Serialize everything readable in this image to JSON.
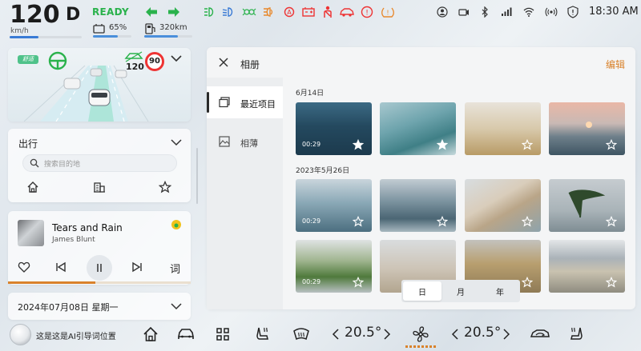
{
  "status": {
    "speed": "120",
    "speed_unit": "km/h",
    "gear": "D",
    "ready": "READY",
    "battery": "65%",
    "battery_level": 0.65,
    "range": "320km",
    "time": "18:30 AM"
  },
  "adas": {
    "mode_badge": "舒适",
    "set_speed": "120",
    "speed_limit": "90"
  },
  "nav": {
    "title": "出行",
    "search_placeholder": "搜索目的地"
  },
  "music": {
    "title": "Tears and Rain",
    "artist": "James Blunt",
    "lyrics_label": "词",
    "progress": 0.48
  },
  "date": "2024年07月08日  星期一",
  "gallery": {
    "title": "相册",
    "edit": "编辑",
    "sidebar": [
      "最近项目",
      "相薄"
    ],
    "sections": [
      {
        "label": "6月14日",
        "items": [
          {
            "duration": "00:29",
            "favorite": true
          },
          {
            "duration": "",
            "favorite": true
          },
          {
            "duration": "",
            "favorite": false
          },
          {
            "duration": "",
            "favorite": false
          }
        ]
      },
      {
        "label": "2023年5月26日",
        "items": [
          {
            "duration": "00:29",
            "favorite": false
          },
          {
            "duration": "",
            "favorite": false
          },
          {
            "duration": "",
            "favorite": false
          },
          {
            "duration": "",
            "favorite": false
          },
          {
            "duration": "00:29",
            "favorite": false
          },
          {
            "duration": "",
            "favorite": false
          },
          {
            "duration": "",
            "favorite": false
          },
          {
            "duration": "",
            "favorite": false
          }
        ]
      }
    ],
    "segments": [
      "日",
      "月",
      "年"
    ],
    "active_segment": "日"
  },
  "dock": {
    "ai_hint": "这是这是AI引导词位置",
    "left_temp": "20.5°",
    "right_temp": "20.5°"
  },
  "colors": {
    "accent": "#d9822b",
    "ready_green": "#2ab24c",
    "warning_red": "#e33333"
  }
}
